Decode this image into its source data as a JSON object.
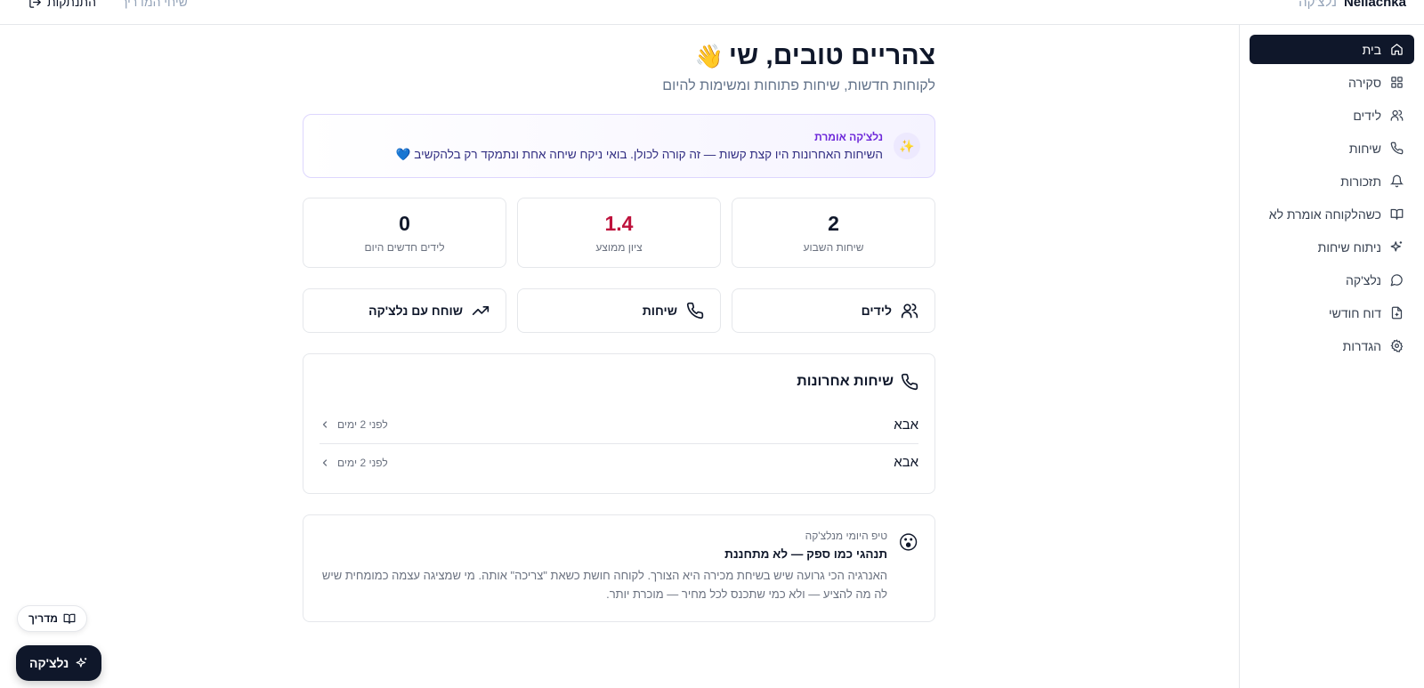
{
  "topbar": {
    "brand_name": "Nellachka",
    "brand_sub": "נלצ'קה",
    "guide_link": "שיחי המדריך",
    "logout_label": "התנתקות"
  },
  "sidebar": {
    "items": [
      {
        "label": "בית",
        "icon": "home-icon",
        "active": true
      },
      {
        "label": "סקירה",
        "icon": "grid-icon",
        "active": false
      },
      {
        "label": "לידים",
        "icon": "users-icon",
        "active": false
      },
      {
        "label": "שיחות",
        "icon": "phone-icon",
        "active": false
      },
      {
        "label": "תזכורות",
        "icon": "bell-icon",
        "active": false
      },
      {
        "label": "כשהלקוחה אומרת לא",
        "icon": "book-icon",
        "active": false
      },
      {
        "label": "ניתוח שיחות",
        "icon": "sparkles-icon",
        "active": false
      },
      {
        "label": "נלצ'קה",
        "icon": "chat-icon",
        "active": false
      },
      {
        "label": "דוח חודשי",
        "icon": "report-icon",
        "active": false
      },
      {
        "label": "הגדרות",
        "icon": "gear-icon",
        "active": false
      }
    ]
  },
  "header": {
    "greeting": "צהריים טובים, שי",
    "wave": "👋",
    "subtitle": "לקוחות חדשות, שיחות פתוחות ומשימות להיום"
  },
  "insight": {
    "icon": "✨",
    "label": "נלצ'קה אומרת",
    "text": "השיחות האחרונות היו קצת קשות — זה קורה לכולן. בואי ניקח שיחה אחת ונתמקד רק בלהקשיב 💙"
  },
  "stats": [
    {
      "value": "2",
      "label": "שיחות השבוע",
      "accent": false
    },
    {
      "value": "1.4",
      "label": "ציון ממוצע",
      "accent": true
    },
    {
      "value": "0",
      "label": "לידים חדשים היום",
      "accent": false
    }
  ],
  "actions": [
    {
      "label": "לידים",
      "icon": "users-icon"
    },
    {
      "label": "שיחות",
      "icon": "phone-icon"
    },
    {
      "label": "שוחח עם נלצ'קה",
      "icon": "trending-up-icon"
    }
  ],
  "recent_calls": {
    "title": "שיחות אחרונות",
    "rows": [
      {
        "name": "אבא",
        "time": "לפני 2 ימים"
      },
      {
        "name": "אבא",
        "time": "לפני 2 ימים"
      }
    ]
  },
  "tip": {
    "emoji": "😮",
    "label": "טיפ היומי מנלצ'קה",
    "title": "תנהגי כמו ספק — לא מתחננת",
    "text": "האנרגיה הכי גרועה שיש בשיחת מכירה היא הצורך. לקוחה חושת כשאת \"צריכה\" אותה. מי שמציגה עצמה כמומחית שיש לה מה להציע — ולא כמי שתכנס לכל מחיר — מוכרת יותר."
  },
  "floating": {
    "guide_label": "מדריך",
    "assistant_label": "נלצ'קה"
  },
  "colors": {
    "primary": "#0f172a",
    "accent_score": "#be123c",
    "insight_label": "#6d28d9"
  }
}
